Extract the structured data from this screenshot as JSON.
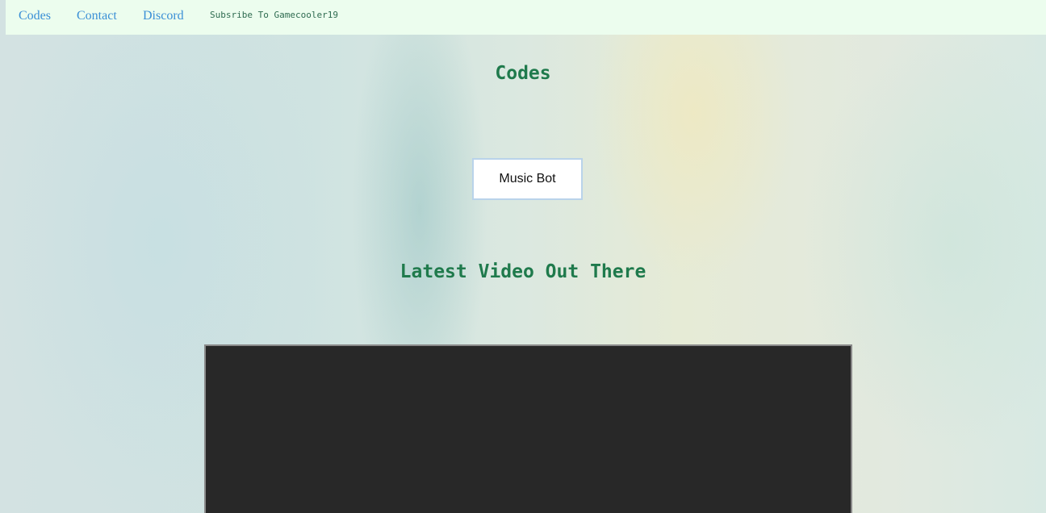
{
  "nav": {
    "links": [
      {
        "label": "Codes"
      },
      {
        "label": "Contact"
      },
      {
        "label": "Discord"
      }
    ],
    "subscribe_text": "Subsribe To Gamecooler19"
  },
  "main": {
    "heading": "Codes",
    "music_button_label": "Music Bot",
    "latest_heading": "Latest Video Out There"
  },
  "colors": {
    "navbar_bg": "#ecfdee",
    "nav_link": "#3a8fd6",
    "heading": "#1f7a4c",
    "video_bg": "#282828"
  }
}
